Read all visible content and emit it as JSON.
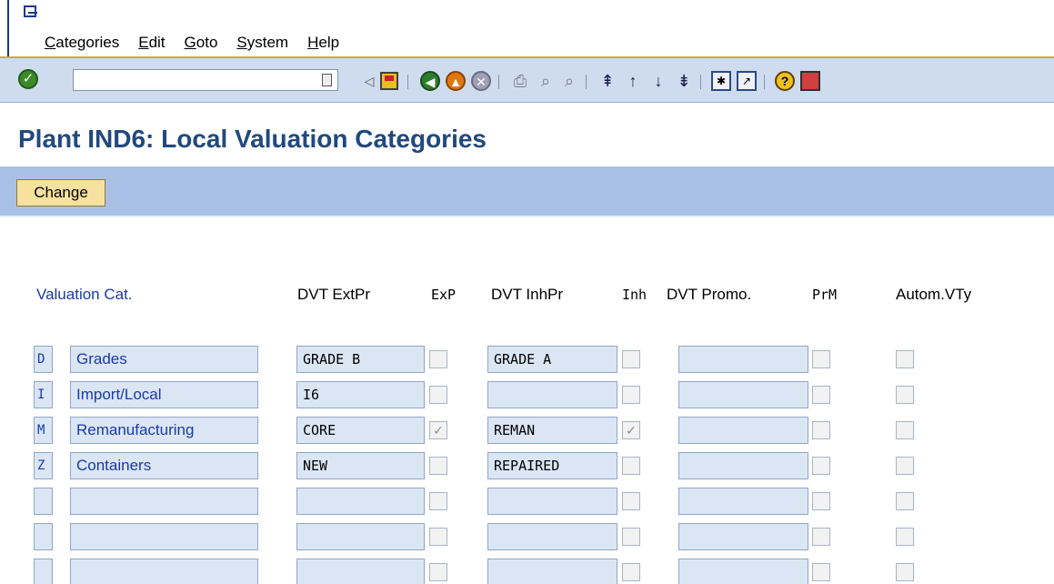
{
  "menu": {
    "items": [
      "Categories",
      "Edit",
      "Goto",
      "System",
      "Help"
    ]
  },
  "toolbar": {
    "command_value": "",
    "icons": [
      "enter-icon",
      "command-history-icon",
      "back-small-icon",
      "save-icon",
      "back-icon",
      "exit-icon",
      "cancel-icon",
      "print-icon",
      "find-icon",
      "find-next-icon",
      "first-page-icon",
      "previous-page-icon",
      "next-page-icon",
      "last-page-icon",
      "create-session-icon",
      "generate-shortcut-icon",
      "help-icon",
      "customize-layout-icon"
    ]
  },
  "page": {
    "title": "Plant IND6: Local Valuation Categories"
  },
  "app_toolbar": {
    "change_label": "Change"
  },
  "columns": {
    "valuation_cat": "Valuation Cat.",
    "dvt_extpr": "DVT ExtPr",
    "exp": "ExP",
    "dvt_inhpr": "DVT InhPr",
    "inh": "Inh",
    "dvt_promo": "DVT Promo.",
    "prm": "PrM",
    "autom_vty": "Autom.VTy"
  },
  "rows": [
    {
      "key": "D",
      "desc": "Grades",
      "extpr": "GRADE B",
      "exp": false,
      "inhpr": "GRADE A",
      "inh": false,
      "promo": "",
      "prm": false,
      "autom": false
    },
    {
      "key": "I",
      "desc": "Import/Local",
      "extpr": "I6",
      "exp": false,
      "inhpr": "",
      "inh": false,
      "promo": "",
      "prm": false,
      "autom": false
    },
    {
      "key": "M",
      "desc": "Remanufacturing",
      "extpr": "CORE",
      "exp": true,
      "inhpr": "REMAN",
      "inh": true,
      "promo": "",
      "prm": false,
      "autom": false
    },
    {
      "key": "Z",
      "desc": "Containers",
      "extpr": "NEW",
      "exp": false,
      "inhpr": "REPAIRED",
      "inh": false,
      "promo": "",
      "prm": false,
      "autom": false
    },
    {
      "key": "",
      "desc": "",
      "extpr": "",
      "exp": false,
      "inhpr": "",
      "inh": false,
      "promo": "",
      "prm": false,
      "autom": false
    },
    {
      "key": "",
      "desc": "",
      "extpr": "",
      "exp": false,
      "inhpr": "",
      "inh": false,
      "promo": "",
      "prm": false,
      "autom": false
    },
    {
      "key": "",
      "desc": "",
      "extpr": "",
      "exp": false,
      "inhpr": "",
      "inh": false,
      "promo": "",
      "prm": false,
      "autom": false
    }
  ],
  "colors": {
    "title": "#21497e",
    "toolbar_bg": "#cfdcef",
    "app_toolbar_bg": "#a9c1e4",
    "field_bg": "#dbe6f5",
    "button_bg": "#f6e29e",
    "accent_line": "#f0a020"
  }
}
